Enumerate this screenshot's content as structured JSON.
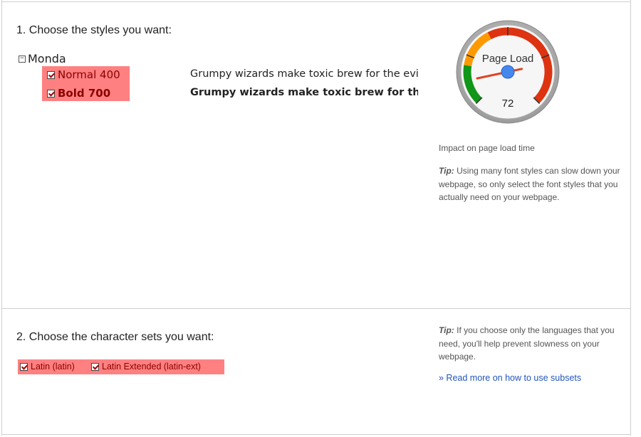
{
  "section1": {
    "heading": "1. Choose the styles you want:",
    "family": "Monda",
    "collapse_symbol": "−",
    "styles": [
      {
        "label": "Normal 400",
        "checked": true,
        "preview": "Grumpy wizards make toxic brew for the evil Queen and Jack."
      },
      {
        "label": "Bold 700",
        "checked": true,
        "preview": "Grumpy wizards make toxic brew for the evil Queen and Jack."
      }
    ],
    "gauge": {
      "title": "Page Load",
      "value": "72",
      "level": 72
    },
    "impact": "Impact on page load time",
    "tip_label": "Tip:",
    "tip_text": " Using many font styles can slow down your webpage, so only select the font styles that you actually need on your webpage."
  },
  "section2": {
    "heading": "2. Choose the character sets you want:",
    "charsets": [
      {
        "label": "Latin (latin)",
        "checked": true
      },
      {
        "label": "Latin Extended (latin-ext)",
        "checked": true
      }
    ],
    "tip_label": "Tip:",
    "tip_text": " If you choose only the languages that you need, you'll help prevent slowness on your webpage.",
    "link": "» Read more on how to use subsets"
  },
  "colors": {
    "highlight": "#ff8080",
    "gauge_red": "#dd3311",
    "gauge_orange": "#ff9900",
    "gauge_green": "#109618",
    "needle_cap": "#4488ee",
    "link": "#2255bb"
  }
}
